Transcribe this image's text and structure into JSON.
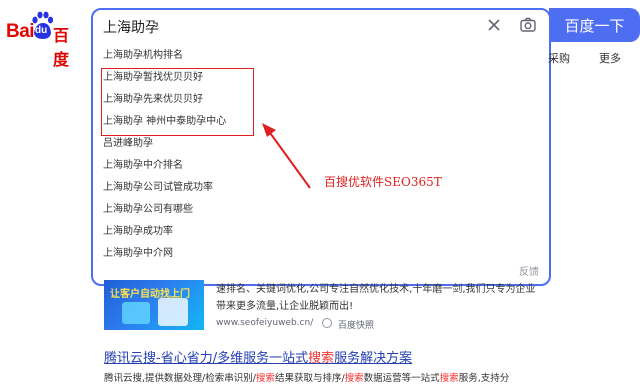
{
  "logo": {
    "bai": "Bai",
    "du": "du",
    "cn": "百度"
  },
  "search": {
    "query": "上海助孕",
    "button_label": "百度一下",
    "clear_icon": "close-icon",
    "camera_icon": "camera-icon"
  },
  "nav": {
    "caigou": "采购",
    "more": "更多"
  },
  "suggestions": [
    "上海助孕机构排名",
    "上海助孕暂找优贝贝好",
    "上海助孕先来优贝贝好",
    "上海助孕 神州中泰助孕中心",
    "吕进峰助孕",
    "上海助孕中介排名",
    "上海助孕公司试管成功率",
    "上海助孕公司有哪些",
    "上海助孕成功率",
    "上海助孕中介网"
  ],
  "feedback": "反馈",
  "annotation": {
    "text": "百搜优软件SEO365T",
    "color": "#e02020"
  },
  "result1": {
    "thumb_text": "让客户自动找上门",
    "line1": "速排名、关键词优化,公司专注自然优化技术,十年磨一剑,我们只专为企业",
    "line2": "带来更多流量,让企业脱颖而出!",
    "url": "www.seofeiyuweb.cn/",
    "snapshot": "百度快照"
  },
  "result2": {
    "title_pre": "腾讯云搜-省心省力/多维服务一站式",
    "title_kw": "搜索",
    "title_post": "服务解决方案",
    "desc_a": "腾讯云搜,提供数据处理/检索串识别/",
    "desc_kw1": "搜索",
    "desc_b": "结果获取与排序/",
    "desc_kw2": "搜索",
    "desc_c": "数据运营等一站式",
    "desc_kw3": "搜索",
    "desc_d": "服务,支持分"
  },
  "colors": {
    "brand_blue": "#4e6ef2",
    "logo_red": "#e10602",
    "link": "#2440b3",
    "keyword_red": "#f73131"
  }
}
